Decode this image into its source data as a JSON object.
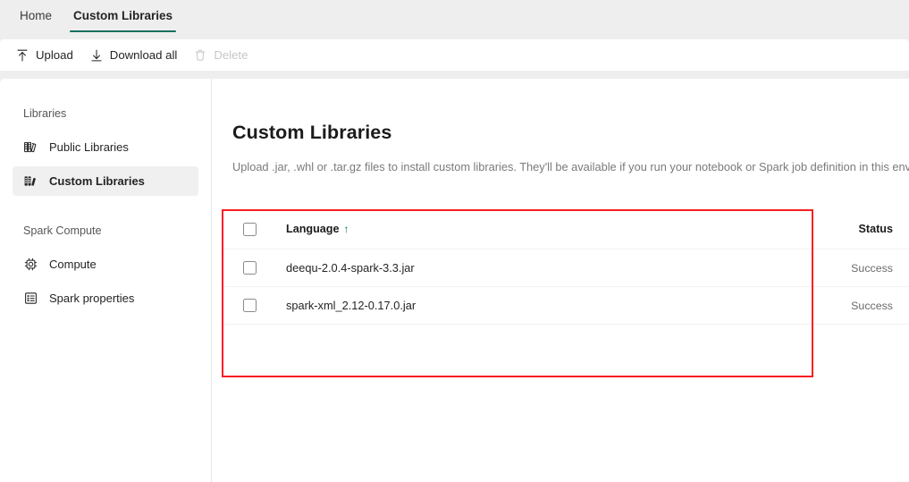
{
  "tabs": [
    {
      "label": "Home",
      "active": false
    },
    {
      "label": "Custom Libraries",
      "active": true
    }
  ],
  "toolbar": {
    "upload_label": "Upload",
    "download_all_label": "Download all",
    "delete_label": "Delete"
  },
  "sidebar": {
    "group1_title": "Libraries",
    "group2_title": "Spark Compute",
    "items": [
      {
        "label": "Public Libraries",
        "icon": "books-outline-icon",
        "selected": false
      },
      {
        "label": "Custom Libraries",
        "icon": "books-filled-icon",
        "selected": true
      },
      {
        "label": "Compute",
        "icon": "cpu-chip-icon",
        "selected": false
      },
      {
        "label": "Spark properties",
        "icon": "properties-list-icon",
        "selected": false
      }
    ]
  },
  "main": {
    "title": "Custom Libraries",
    "description": "Upload .jar, .whl or .tar.gz files to install custom libraries. They'll be available if you run your notebook or Spark job definition in this environment."
  },
  "table": {
    "columns": {
      "language": "Language",
      "sort_indicator": "↑",
      "status": "Status"
    },
    "rows": [
      {
        "name": "deequ-2.0.4-spark-3.3.jar",
        "status": "Success",
        "checked": false
      },
      {
        "name": "spark-xml_2.12-0.17.0.jar",
        "status": "Success",
        "checked": false
      }
    ]
  },
  "annotation": {
    "highlight_color": "#fa1e23"
  },
  "colors": {
    "accent_green": "#0f6e5e",
    "page_background": "#efeeee",
    "panel_background": "#ffffff"
  }
}
